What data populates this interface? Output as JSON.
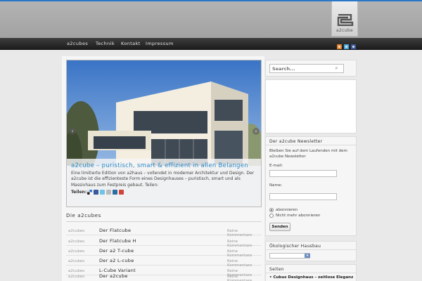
{
  "header": {
    "logo_text": "a2cube"
  },
  "nav": {
    "items": [
      "a2cubes",
      "Technik",
      "Kontakt",
      "Impressum"
    ]
  },
  "slider": {
    "title": "a2cube – puristisch, smart & effizient in allen Belangen",
    "text": "Eine limitierte Edition von a2haus – vollendet in modemer Architektur und Design. Der a2cube ist die effizienteste Form eines Designhauses – puristisch, smart und als Massivhaus zum Festpreis gebaut. Teilen:",
    "share_label": "Teilen:",
    "share_icons": [
      "delicious-icon",
      "facebook-icon",
      "twitter-icon",
      "email-icon",
      "linkedin-icon",
      "google-icon"
    ]
  },
  "section": {
    "title": "Die a2cubes"
  },
  "posts": [
    {
      "author": "a2cubes",
      "title": "Der Flatcube",
      "comments": "Keine Kommentare"
    },
    {
      "author": "a2cubes",
      "title": "Der Flatcube H",
      "comments": "Keine Kommentare"
    },
    {
      "author": "a2cubes",
      "title": "Der a2 T-cube",
      "comments": "Keine Kommentare"
    },
    {
      "author": "a2cubes",
      "title": "Der a2 L-cube",
      "comments": "Keine Kommentare"
    },
    {
      "author": "a2cubes",
      "title": "L-Cube Variant",
      "comments": "Keine Kommentare"
    },
    {
      "author": "a2cubes",
      "title": "Der a2cube",
      "comments": "Keine Kommentare"
    }
  ],
  "sidebar": {
    "search_placeholder": "Search...",
    "newsletter": {
      "title": "Der a2cube Newsletter",
      "intro": "Bleiben Sie auf dem Laufenden mit dem a2cube Newsletter",
      "email_label": "E-mail:",
      "name_label": "Name:",
      "subscribe_label": "abonnieren",
      "unsubscribe_label": "Nicht mehr abonnieren",
      "submit_label": "Senden"
    },
    "oeko_title": "Ökologischer Hausbau",
    "seiten_title": "Seiten",
    "seiten_link": "Cubus Designhaus – zeitlose Eleganz"
  },
  "colors": {
    "accent": "#2b8ac8",
    "nav_bg": "#2a2a2a"
  }
}
